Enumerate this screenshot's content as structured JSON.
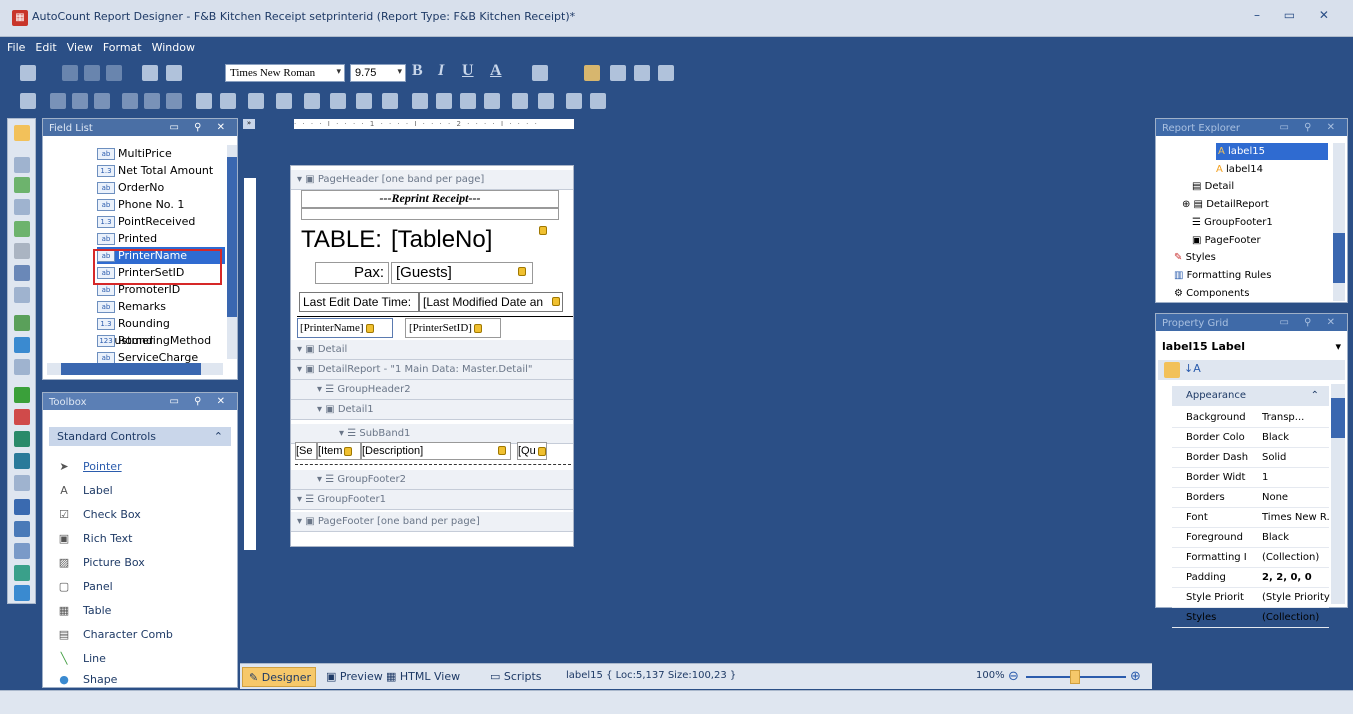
{
  "window": {
    "title": "AutoCount Report Designer - F&B Kitchen Receipt setprinterid (Report Type: F&B Kitchen Receipt)*",
    "controls": "–  ▭  ✕"
  },
  "menu": [
    "File",
    "Edit",
    "View",
    "Format",
    "Window"
  ],
  "toolbar": {
    "font_name": "Times New Roman",
    "font_size": "9.75"
  },
  "field_list": {
    "title": "Field List",
    "items": [
      {
        "label": "MultiPrice",
        "type": "ab"
      },
      {
        "label": "Net Total Amount",
        "type": "1.3"
      },
      {
        "label": "OrderNo",
        "type": "ab"
      },
      {
        "label": "Phone No. 1",
        "type": "ab"
      },
      {
        "label": "PointReceived",
        "type": "1.3"
      },
      {
        "label": "Printed",
        "type": "ab"
      },
      {
        "label": "PrinterName",
        "type": "ab"
      },
      {
        "label": "PrinterSetID",
        "type": "ab"
      },
      {
        "label": "PromoterID",
        "type": "ab"
      },
      {
        "label": "Remarks",
        "type": "ab"
      },
      {
        "label": "Rounding Adjustmer",
        "type": "1.3"
      },
      {
        "label": "RoundingMethod",
        "type": "123"
      },
      {
        "label": "ServiceCharge",
        "type": "ab"
      }
    ]
  },
  "toolbox": {
    "title": "Toolbox",
    "section": "Standard Controls",
    "items": [
      "Pointer",
      "Label",
      "Check Box",
      "Rich Text",
      "Picture Box",
      "Panel",
      "Table",
      "Character Comb",
      "Line",
      "Shape"
    ]
  },
  "designer": {
    "ruler": "· · · · I · · · · 1 · · · · I · · · · 2 · · · · I · · · ·",
    "bands": {
      "page_header": "PageHeader [one band per page]",
      "detail": "Detail",
      "detail_report": "DetailReport - \"1 Main Data:  Master.Detail\"",
      "group_header2": "GroupHeader2",
      "detail1": "Detail1",
      "subband1": "SubBand1",
      "group_footer2": "GroupFooter2",
      "group_footer1": "GroupFooter1",
      "page_footer": "PageFooter [one band per page]"
    },
    "labels": {
      "reprint": "---Reprint Receipt---",
      "table_label": "TABLE:",
      "table_no": "[TableNo]",
      "pax_label": "Pax:",
      "guests": "[Guests]",
      "last_edit": "Last Edit Date Time:",
      "last_modified": "[Last Modified Date an",
      "printer_name": "[PrinterName]",
      "printer_set_id": "[PrinterSetID]",
      "seq": "[Se",
      "item": "[Item",
      "description": "[Description]",
      "qty": "[Qu"
    }
  },
  "report_explorer": {
    "title": "Report Explorer",
    "items": [
      "label15",
      "label14",
      "Detail",
      "DetailReport",
      "GroupFooter1",
      "PageFooter",
      "Styles",
      "Formatting Rules",
      "Components"
    ]
  },
  "property_grid": {
    "title": "Property Grid",
    "selector": "label15  Label",
    "category": "Appearance",
    "rows": [
      {
        "name": "Background",
        "value": "Transp..."
      },
      {
        "name": "Border Colo",
        "value": "Black"
      },
      {
        "name": "Border Dash",
        "value": "Solid"
      },
      {
        "name": "Border Widt",
        "value": "1"
      },
      {
        "name": "Borders",
        "value": "None"
      },
      {
        "name": "Font",
        "value": "Times New R..."
      },
      {
        "name": "Foreground",
        "value": "Black"
      },
      {
        "name": "Formatting I",
        "value": "(Collection)"
      },
      {
        "name": "Padding",
        "value": "2, 2, 0, 0"
      },
      {
        "name": "Style Priorit",
        "value": "(Style Priority)"
      },
      {
        "name": "Styles",
        "value": "(Collection)"
      }
    ]
  },
  "statusbar": {
    "designer": "Designer",
    "preview": "Preview",
    "html_view": "HTML View",
    "scripts": "Scripts",
    "info": "label15 { Loc:5,137 Size:100,23 }",
    "zoom": "100%"
  },
  "colors": {
    "accent": "#2b4f86",
    "selection": "#2f6bd1",
    "highlight_box": "#d62828"
  }
}
